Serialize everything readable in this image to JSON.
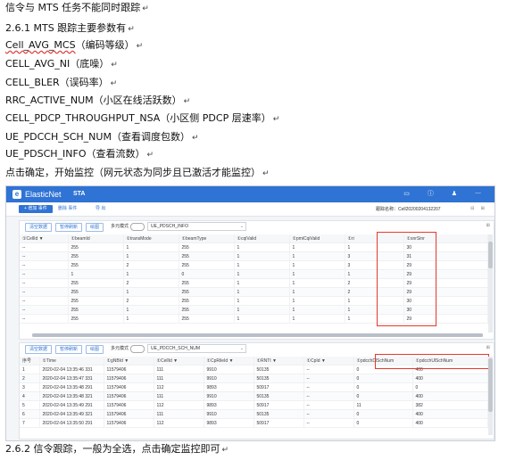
{
  "doc": {
    "lines": [
      "信令与 MTS 任务不能同时跟踪",
      "2.6.1 MTS 跟踪主要参数有",
      "Cell_AVG_MCS（编码等级）",
      "CELL_AVG_NI（底噪）",
      "CELL_BLER（误码率）",
      "RRC_ACTIVE_NUM（小区在线活跃数）",
      "CELL_PDCP_THROUGHPUT_NSA（小区侧 PDCP 层速率）",
      "UE_PDCCH_SCH_NUM（查看调度包数）",
      "UE_PDSCH_INFO（查看流数）",
      "点击确定，开始监控（网元状态为同步且已激活才能监控）"
    ],
    "line3_rest": "（编码等级）",
    "line3_code": "Cell_AVG_MCS",
    "last_line": "2.6.2  信令跟踪，一般为全选，点击确定监控即可",
    "para_mark": "↵"
  },
  "app": {
    "brand": "ElasticNet",
    "name": "STA",
    "logo": "e",
    "header_icons": "▭ ⓘ ♟ ⋯",
    "toolbar": {
      "add_task": "+ 增加 事件",
      "delete_task": "删除 事件",
      "export": "导 出",
      "task_name": "跟踪名称：Cell20200204132207",
      "right_icons": "⊟ ⊞"
    },
    "panel_top": {
      "clear": "清空数据",
      "pause": "暂停刷新",
      "chart": "绘图",
      "multi_mode": "多元模式",
      "select": "UE_PDSCH_INFO",
      "columns": [
        "①CellId ▼",
        "①beamId",
        "①transMode",
        "①beamType",
        "①cqiValid",
        "①pmiCqiValid",
        "①ri",
        "①snrSinr"
      ],
      "rows": [
        [
          "--",
          "255",
          "1",
          "255",
          "1",
          "1",
          "1",
          "30"
        ],
        [
          "--",
          "255",
          "1",
          "255",
          "1",
          "1",
          "3",
          "31"
        ],
        [
          "--",
          "255",
          "2",
          "255",
          "1",
          "1",
          "3",
          "29"
        ],
        [
          "--",
          "1",
          "1",
          "0",
          "1",
          "1",
          "1",
          "29"
        ],
        [
          "--",
          "255",
          "2",
          "255",
          "1",
          "1",
          "2",
          "29"
        ],
        [
          "--",
          "255",
          "1",
          "255",
          "1",
          "1",
          "2",
          "29"
        ],
        [
          "--",
          "255",
          "2",
          "255",
          "1",
          "1",
          "1",
          "30"
        ],
        [
          "--",
          "255",
          "1",
          "255",
          "1",
          "1",
          "1",
          "30"
        ],
        [
          "--",
          "255",
          "1",
          "255",
          "1",
          "1",
          "1",
          "29"
        ]
      ]
    },
    "panel_bottom": {
      "clear": "清空数据",
      "pause": "暂停刷新",
      "chart": "绘图",
      "multi_mode": "多元模式",
      "select": "UE_PDCCH_SCH_NUM",
      "columns": [
        "序号",
        "①Time",
        "①gNBId ▼",
        "①CellId ▼",
        "①CpRileId ▼",
        "①RNTI ▼",
        "①CpId ▼",
        "①pdcchDlSchNum",
        "①pdcchUlSchNum"
      ],
      "rows": [
        [
          "1",
          "2020-02-04 13:35:46 331",
          "11579406",
          "111",
          "9910",
          "50135",
          "--",
          "0",
          "400"
        ],
        [
          "2",
          "2020-02-04 13:35:47 331",
          "11579406",
          "111",
          "9910",
          "50135",
          "--",
          "0",
          "400"
        ],
        [
          "3",
          "2020-02-04 13:35:48 291",
          "11579406",
          "112",
          "9893",
          "50917",
          "--",
          "0",
          "0"
        ],
        [
          "4",
          "2020-02-04 13:35:48 321",
          "11579406",
          "111",
          "9910",
          "50135",
          "--",
          "0",
          "400"
        ],
        [
          "5",
          "2020-02-04 13:35:49 291",
          "11579406",
          "112",
          "9893",
          "50917",
          "--",
          "11",
          "382"
        ],
        [
          "6",
          "2020-02-04 13:35:49 321",
          "11579406",
          "111",
          "9910",
          "50135",
          "--",
          "0",
          "400"
        ],
        [
          "7",
          "2020-02-04 13:35:50 291",
          "11579406",
          "112",
          "9893",
          "50917",
          "--",
          "0",
          "400"
        ]
      ]
    },
    "colors": {
      "header": "#2f73d4",
      "highlight": "#e23b2e"
    }
  }
}
